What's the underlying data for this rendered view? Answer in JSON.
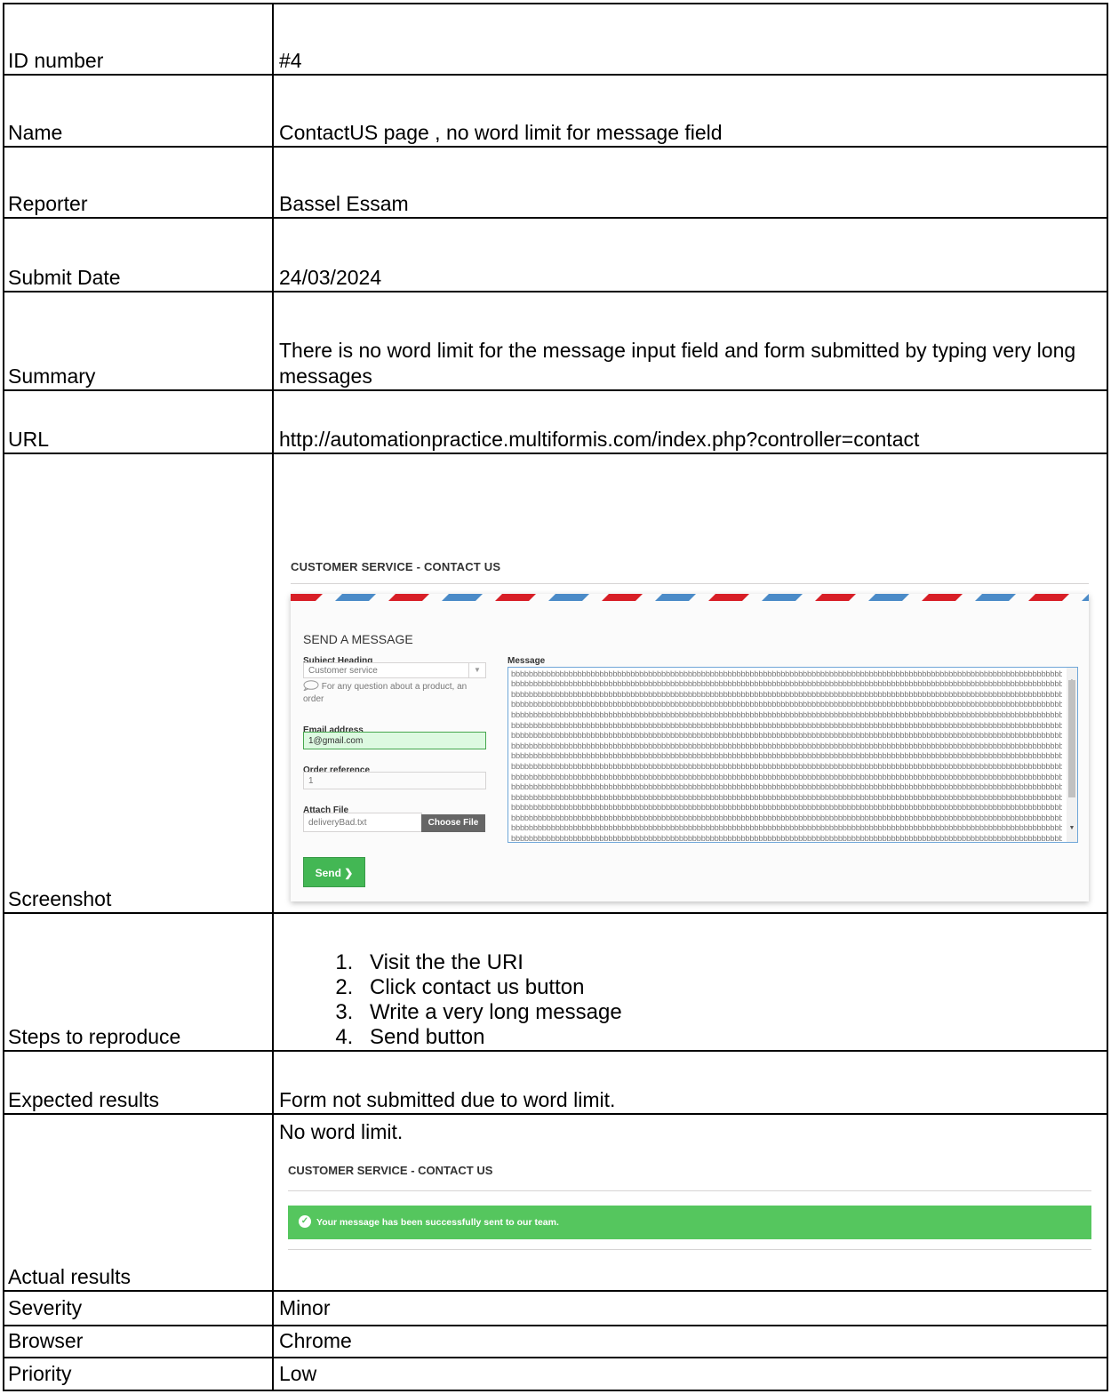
{
  "rows": {
    "id": {
      "label": "ID number",
      "value": "#4"
    },
    "name": {
      "label": "Name",
      "value": "ContactUS page , no word limit for message field"
    },
    "reporter": {
      "label": "Reporter",
      "value": "Bassel Essam"
    },
    "date": {
      "label": "Submit Date",
      "value": "24/03/2024"
    },
    "summary": {
      "label": "Summary",
      "value": "There is no word limit for the message input field and form submitted by typing very long messages"
    },
    "url": {
      "label": "URL",
      "value": "http://automationpractice.multiformis.com/index.php?controller=contact"
    },
    "screenshot": {
      "label": "Screenshot"
    },
    "steps": {
      "label": "Steps to reproduce",
      "items": [
        "Visit the the URI",
        "Click contact us button",
        "Write a very long message",
        "Send button"
      ]
    },
    "expected": {
      "label": "Expected results",
      "value": "Form not submitted due to word limit."
    },
    "actual": {
      "label": "Actual results",
      "value": "No word limit."
    },
    "severity": {
      "label": "Severity",
      "value": "Minor"
    },
    "browser": {
      "label": "Browser",
      "value": "Chrome"
    },
    "priority": {
      "label": "Priority",
      "value": "Low"
    }
  },
  "form_shot": {
    "page_title": "CUSTOMER SERVICE - CONTACT US",
    "heading": "SEND A MESSAGE",
    "subject_label": "Subject Heading",
    "subject_value": "Customer service",
    "subject_hint": "For any question about a product, an order",
    "email_label": "Email address",
    "email_value": "1@gmail.com",
    "order_label": "Order reference",
    "order_value": "1",
    "file_label": "Attach File",
    "file_value": "deliveryBad.txt",
    "choose_label": "Choose File",
    "message_label": "Message",
    "message_line": "bbbbbbbbbbbbbbbbbbbbbbbbbbbbbbbbbbbbbbbbbbbbbbbbbbbbbbbbbbbbbbbbbbbbbbbbbbbbbbbbbbbbbbbbbbbbbbbbbbbbbbbbbbbbbbbbbbbbbbbbbbbbb",
    "send_label": "Send ❯",
    "stripe_colors": [
      "#d81e26",
      "#4b8bc8"
    ]
  },
  "result_shot": {
    "page_title": "CUSTOMER SERVICE - CONTACT US",
    "success_message": "Your message has been successfully sent to our team."
  }
}
